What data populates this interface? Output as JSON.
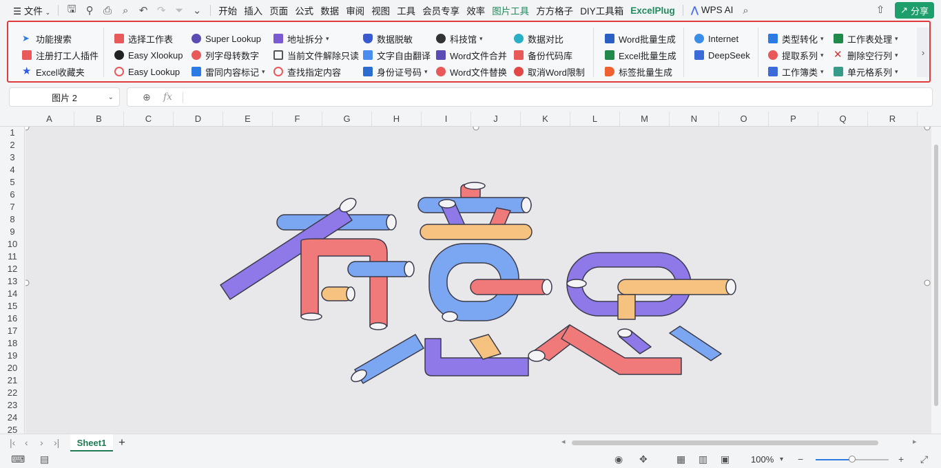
{
  "menubar": {
    "menu_icon": "hamburger-icon",
    "file_label": "文件",
    "tabs": [
      "开始",
      "插入",
      "页面",
      "公式",
      "数据",
      "审阅",
      "视图",
      "工具",
      "会员专享",
      "效率",
      "图片工具",
      "方方格子",
      "DIY工具箱",
      "ExcelPlug"
    ],
    "active_tab": "图片工具",
    "wps_ai_label": "WPS AI",
    "share_label": "分享"
  },
  "ribbon": {
    "col1": [
      "功能搜索",
      "注册打工人插件",
      "Excel收藏夹"
    ],
    "col2": [
      "选择工作表",
      "Easy Xlookup",
      "Easy Lookup"
    ],
    "col3": [
      "Super Lookup",
      "列字母转数字",
      "雷同内容标记"
    ],
    "col4": [
      "地址拆分",
      "当前文件解除只读",
      "查找指定内容"
    ],
    "col5": [
      "数据脱敏",
      "文字自由翻译",
      "身份证号码"
    ],
    "col6": [
      "科技馆",
      "Word文件合并",
      "Word文件替换"
    ],
    "col7": [
      "数据对比",
      "备份代码库",
      "取消Word限制"
    ],
    "col8": [
      "Word批量生成",
      "Excel批量生成",
      "标签批量生成"
    ],
    "col9": [
      "Internet",
      "DeepSeek"
    ],
    "col10": [
      "类型转化",
      "提取系列",
      "工作簿类"
    ],
    "col11": [
      "工作表处理",
      "删除空行列",
      "单元格系列"
    ]
  },
  "formula_bar": {
    "name_box": "图片 2",
    "fx_label": "fx",
    "content": ""
  },
  "columns": [
    "A",
    "B",
    "C",
    "D",
    "E",
    "F",
    "G",
    "H",
    "I",
    "J",
    "K",
    "L",
    "M",
    "N",
    "O",
    "P",
    "Q",
    "R"
  ],
  "rows": [
    "1",
    "2",
    "3",
    "4",
    "5",
    "6",
    "7",
    "8",
    "9",
    "10",
    "11",
    "12",
    "13",
    "14",
    "15",
    "16",
    "17",
    "18",
    "19",
    "20",
    "21",
    "22",
    "23",
    "24",
    "25"
  ],
  "sheet_tabs": [
    "Sheet1"
  ],
  "status": {
    "zoom": "100%",
    "zoom_level": 0.5
  },
  "colors": {
    "accent": "#1e9e6a",
    "highlight_border": "#e03a3a",
    "tube_blue": "#7aa6f2",
    "tube_purple": "#8f78e8",
    "tube_red": "#f07a7a",
    "tube_orange": "#f6c27f"
  }
}
